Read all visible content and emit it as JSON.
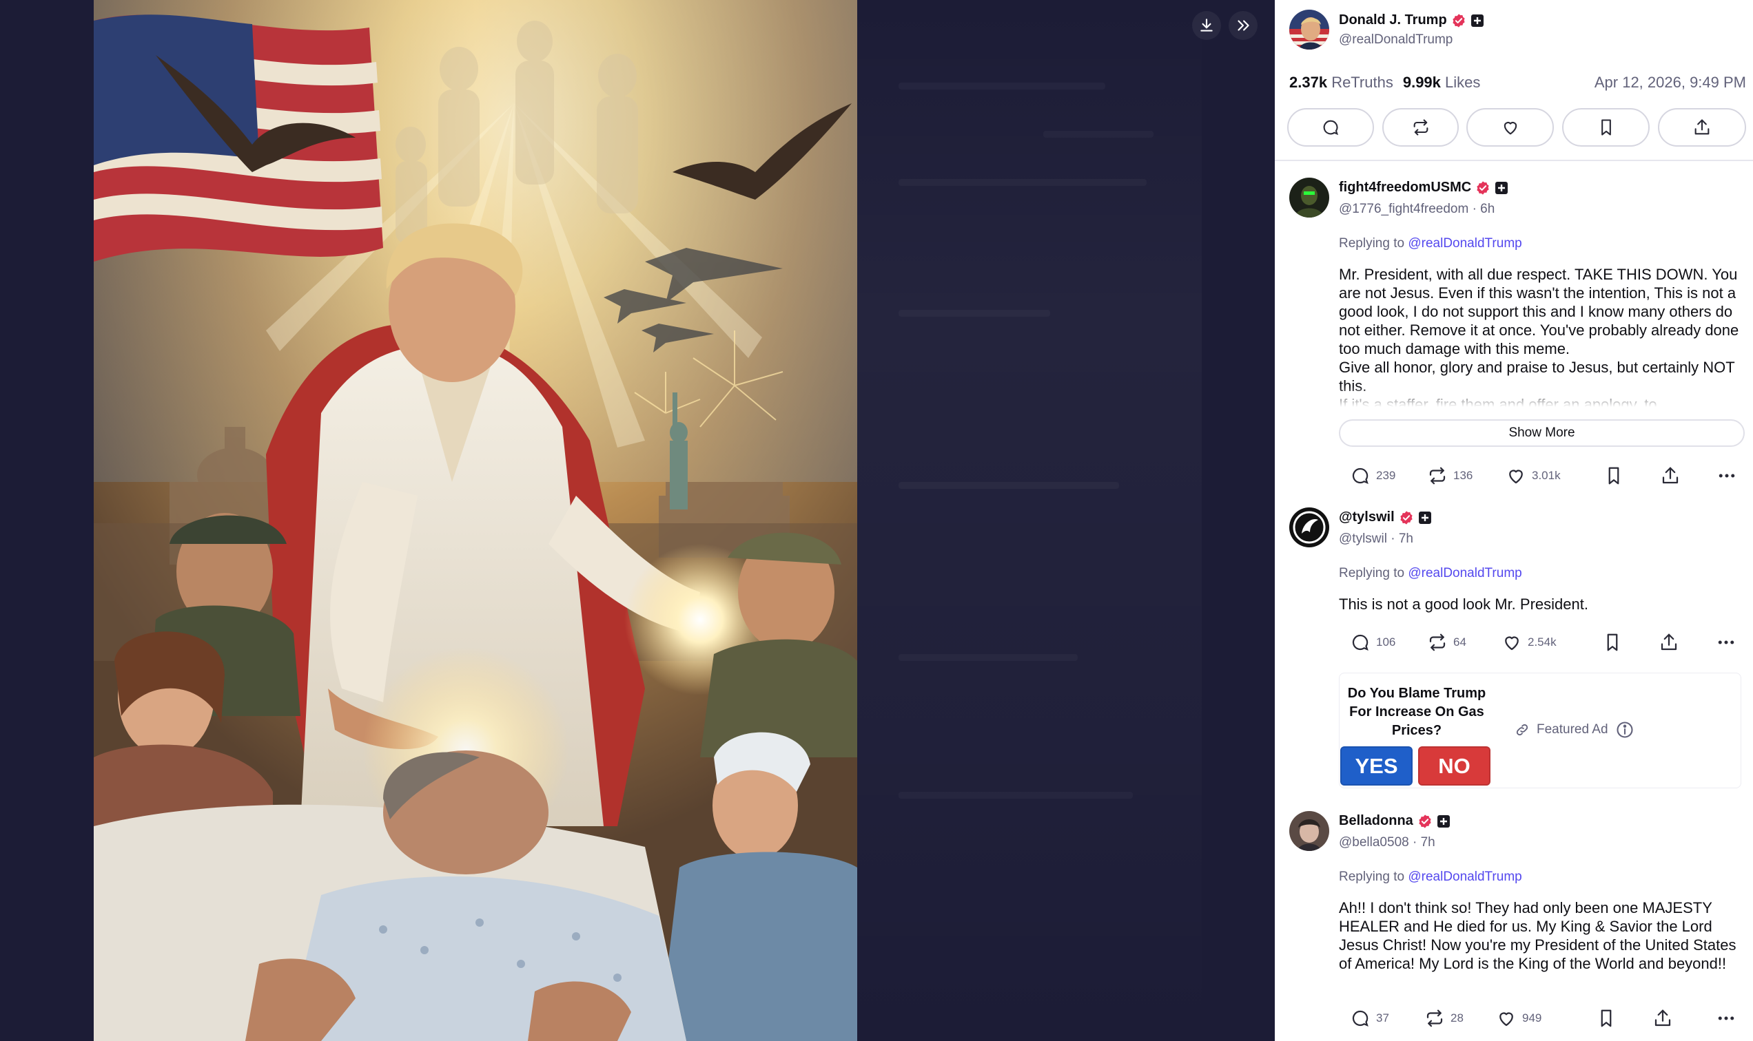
{
  "viewer": {
    "download_label": "Download",
    "collapse_label": "Collapse"
  },
  "post": {
    "author_name": "Donald J. Trump",
    "author_handle": "@realDonaldTrump",
    "retruths_count": "2.37k",
    "retruths_label": "ReTruths",
    "likes_count": "9.99k",
    "likes_label": "Likes",
    "date": "Apr 12, 2026, 9:49 PM"
  },
  "actions": [
    "reply-icon",
    "retruth-icon",
    "like-icon",
    "bookmark-icon",
    "share-icon"
  ],
  "replies": [
    {
      "name": "fight4freedomUSMC",
      "handle": "@1776_fight4freedom · 6h",
      "replying_prefix": "Replying to",
      "replying_to": "@realDonaldTrump",
      "text": "Mr. President, with all due respect. TAKE THIS DOWN. You are not Jesus. Even if this wasn't the intention, This is not a good look, I do not support this and I know many others do not either. Remove it at once. You've probably already done too much damage with this meme.\nGive all honor, glory and praise to Jesus, but certainly NOT this.\nIf it's a staffer, fire them and offer an apology, to",
      "show_more": "Show More",
      "replies_count": "239",
      "retruths": "136",
      "likes": "3.01k"
    },
    {
      "name": "@tylswil",
      "handle": "@tylswil · 7h",
      "replying_prefix": "Replying to",
      "replying_to": "@realDonaldTrump",
      "text": "This is not a good look Mr. President.",
      "replies_count": "106",
      "retruths": "64",
      "likes": "2.54k"
    },
    {
      "name": "Belladonna",
      "handle": "@bella0508 · 7h",
      "replying_prefix": "Replying to",
      "replying_to": "@realDonaldTrump",
      "text": "Ah!! I don't think so! They had only been one MAJESTY HEALER and He died for us. My King & Savior the Lord Jesus Christ! Now you're my President of the United States of America! My Lord is the King of the World and beyond!!",
      "replies_count": "37",
      "retruths": "28",
      "likes": "949"
    }
  ],
  "ad": {
    "question": "Do You Blame Trump For Increase On Gas Prices?",
    "yes": "YES",
    "no": "NO",
    "label": "Featured Ad"
  },
  "colors": {
    "viewer_bg": "#1c1c36",
    "accent_link": "#5448ee",
    "verified_badge": "#e4345a",
    "yes_button": "#1f5fc9",
    "no_button": "#d83a3a"
  }
}
